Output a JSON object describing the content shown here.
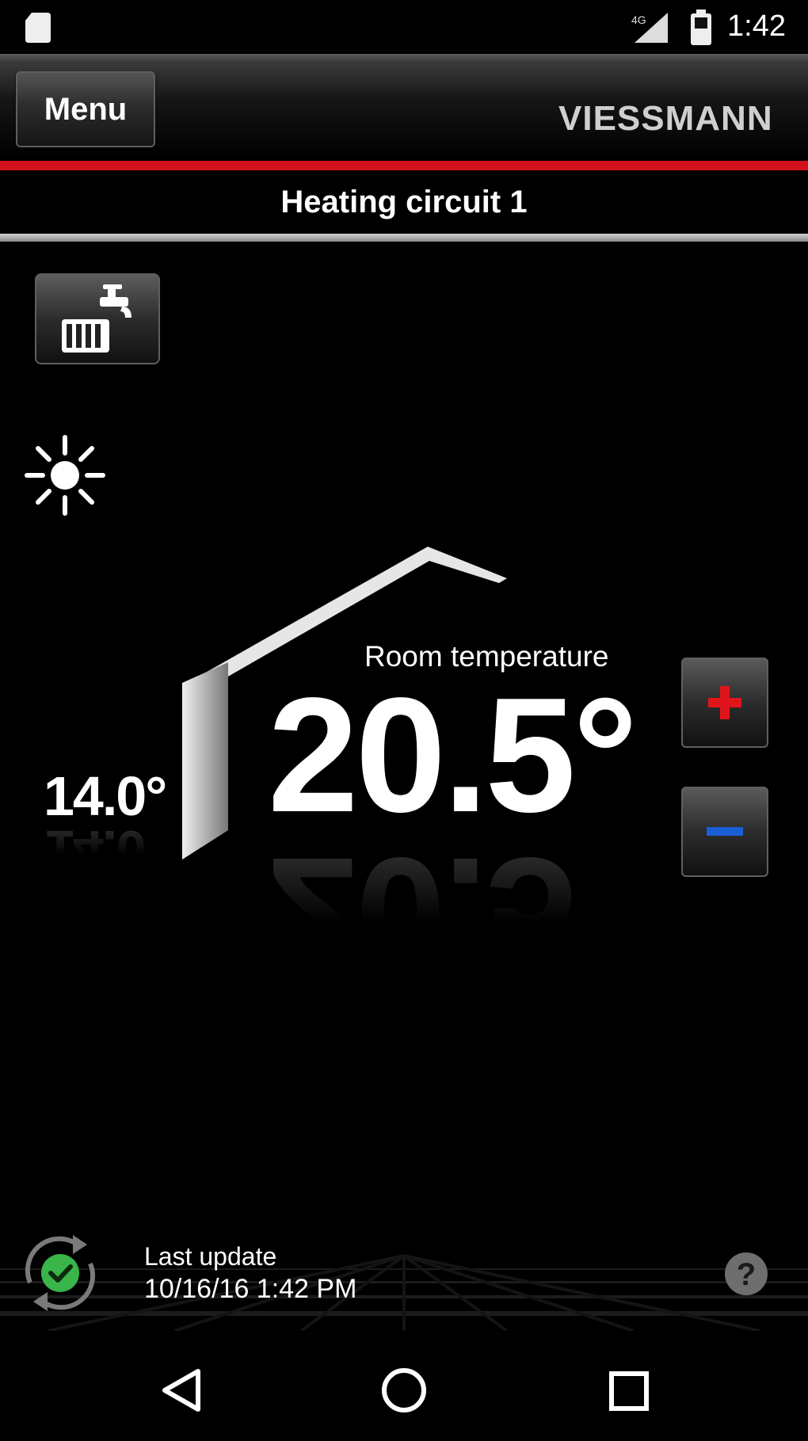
{
  "status_bar": {
    "time": "1:42",
    "icons": [
      "sd-card-icon",
      "signal-icon",
      "battery-icon"
    ]
  },
  "app_bar": {
    "menu_label": "Menu",
    "brand": "VIESSMANN"
  },
  "title": "Heating circuit 1",
  "mode_icon": "radiator-tap-icon",
  "weather_icon": "sun-icon",
  "room": {
    "label": "Room temperature",
    "value": "20.5°"
  },
  "outside_temp": "14.0°",
  "controls": {
    "plus_icon": "plus-icon",
    "minus_icon": "minus-icon"
  },
  "footer": {
    "update_label": "Last update",
    "update_value": "10/16/16 1:42 PM",
    "sync_icon": "sync-check-icon",
    "help_icon": "help-icon"
  },
  "nav": [
    "back-icon",
    "home-icon",
    "recents-icon"
  ],
  "colors": {
    "accent_red": "#d0101a",
    "plus_red": "#e0151b",
    "minus_blue": "#1a5fd6",
    "check_green": "#39b54a"
  }
}
